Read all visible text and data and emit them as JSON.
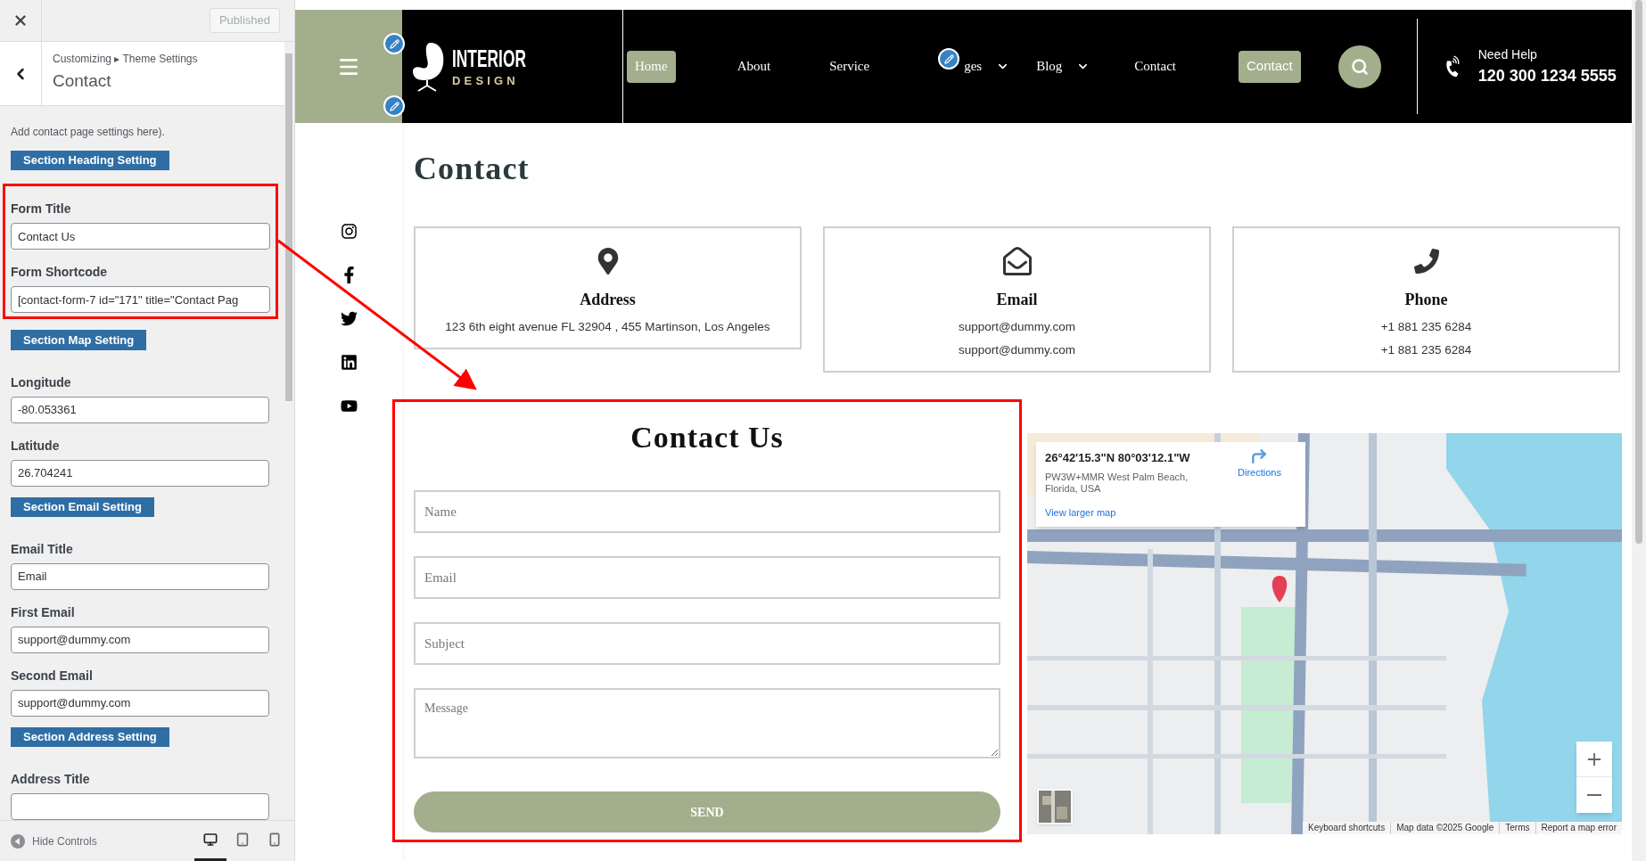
{
  "customizer": {
    "publish_button": {
      "label": "Published",
      "disabled": true
    },
    "breadcrumb": "Customizing ▸ Theme Settings",
    "title": "Contact",
    "controls": [
      {
        "kind": "note",
        "text": "Add contact page settings here)."
      },
      {
        "kind": "section",
        "label": "Section Heading Setting"
      },
      {
        "kind": "group",
        "highlighted": true,
        "fields": [
          {
            "label": "Form Title",
            "value": "Contact Us"
          },
          {
            "label": "Form Shortcode",
            "value": "[contact-form-7 id=\"171\" title=\"Contact Pag"
          }
        ]
      },
      {
        "kind": "section",
        "label": "Section Map Setting"
      },
      {
        "kind": "field",
        "label": "Longitude",
        "value": "-80.053361"
      },
      {
        "kind": "field",
        "label": "Latitude",
        "value": "26.704241"
      },
      {
        "kind": "section",
        "label": "Section Email Setting"
      },
      {
        "kind": "field",
        "label": "Email Title",
        "value": "Email"
      },
      {
        "kind": "field",
        "label": "First Email",
        "value": "support@dummy.com"
      },
      {
        "kind": "field",
        "label": "Second Email",
        "value": "support@dummy.com"
      },
      {
        "kind": "section",
        "label": "Section Address Setting"
      },
      {
        "kind": "field",
        "label": "Address Title"
      }
    ],
    "hide_controls": "Hide Controls",
    "devices": [
      {
        "kind": "desktop",
        "selected": true
      },
      {
        "kind": "tablet",
        "selected": false
      },
      {
        "kind": "mobile",
        "selected": false
      }
    ]
  },
  "site": {
    "logo": {
      "line1": "INTERIOR",
      "line2": "DESIGN"
    },
    "nav": [
      {
        "label": "Home",
        "selected": true,
        "dropdown": false
      },
      {
        "label": "About",
        "selected": false,
        "dropdown": false
      },
      {
        "label": "Service",
        "selected": false,
        "dropdown": false
      },
      {
        "label": "ges",
        "selected": false,
        "dropdown": true
      },
      {
        "label": "Blog",
        "selected": false,
        "dropdown": true
      },
      {
        "label": "Contact",
        "selected": false,
        "dropdown": false
      }
    ],
    "cta_button": "Contact",
    "help": {
      "label": "Need Help",
      "phone": "120 300 1234 5555"
    }
  },
  "page": {
    "heading": "Contact",
    "cards": [
      {
        "kind": "address",
        "title": "Address",
        "lines": [
          "123 6th eight avenue FL 32904 , 455 Martinson, Los Angeles"
        ]
      },
      {
        "kind": "email",
        "title": "Email",
        "lines": [
          "support@dummy.com",
          "support@dummy.com"
        ]
      },
      {
        "kind": "phone",
        "title": "Phone",
        "lines": [
          "+1 881 235 6284",
          "+1 881 235 6284"
        ]
      }
    ],
    "form": {
      "title": "Contact Us",
      "highlighted": true,
      "fields": [
        {
          "kind": "input",
          "placeholder": "Name"
        },
        {
          "kind": "input",
          "placeholder": "Email"
        },
        {
          "kind": "input",
          "placeholder": "Subject"
        },
        {
          "kind": "textarea",
          "placeholder": "Message"
        }
      ],
      "submit": "SEND"
    },
    "map": {
      "info": {
        "coordinates": "26°42'15.3\"N 80°03'12.1\"W",
        "address": "PW3W+MMR West Palm Beach, Florida, USA",
        "directions": "Directions",
        "larger_map": "View larger map"
      },
      "attribution": [
        "Keyboard shortcuts",
        "Map data ©2025 Google",
        "Terms",
        "Report a map error"
      ]
    }
  }
}
